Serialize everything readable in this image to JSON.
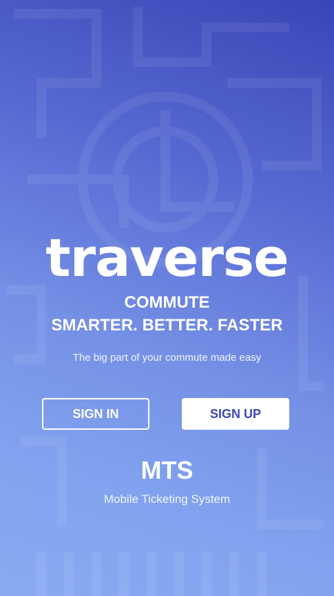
{
  "brand": {
    "logo_text": "traverse"
  },
  "hero": {
    "tagline_line1": "COMMUTE",
    "tagline_line2": "SMARTER. BETTER. FASTER",
    "subtitle": "The big part of your commute made easy"
  },
  "actions": {
    "sign_in_label": "SIGN IN",
    "sign_up_label": "SIGN UP"
  },
  "footer": {
    "title": "MTS",
    "subtitle": "Mobile Ticketing System"
  },
  "colors": {
    "gradient_top": "#3a45b6",
    "gradient_bottom": "#8aaaf1",
    "accent": "#3b48b2",
    "text": "#ffffff"
  }
}
